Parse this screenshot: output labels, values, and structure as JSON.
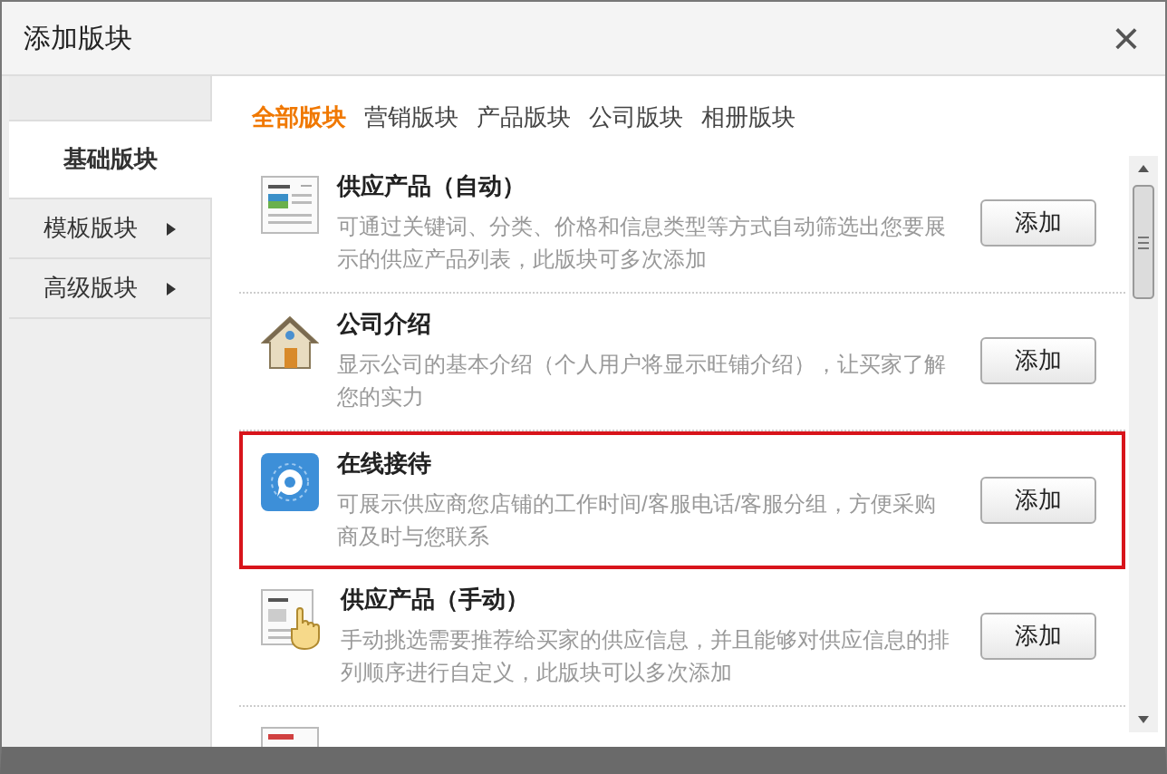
{
  "window": {
    "title": "添加版块",
    "close": "×"
  },
  "sidebar": {
    "items": [
      {
        "label": "基础版块",
        "selected": true,
        "submenu": false
      },
      {
        "label": "模板版块",
        "selected": false,
        "submenu": true
      },
      {
        "label": "高级版块",
        "selected": false,
        "submenu": true
      }
    ]
  },
  "tabs": [
    {
      "label": "全部版块",
      "selected": true
    },
    {
      "label": "营销版块",
      "selected": false
    },
    {
      "label": "产品版块",
      "selected": false
    },
    {
      "label": "公司版块",
      "selected": false
    },
    {
      "label": "相册版块",
      "selected": false
    }
  ],
  "modules": [
    {
      "kind": "document",
      "title": "供应产品（自动）",
      "description": "可通过关键词、分类、价格和信息类型等方式自动筛选出您要展示的供应产品列表，此版块可多次添加",
      "button": "添加",
      "highlighted": false
    },
    {
      "kind": "house",
      "title": "公司介绍",
      "description": "显示公司的基本介绍（个人用户将显示旺铺介绍），让买家了解您的实力",
      "button": "添加",
      "highlighted": false
    },
    {
      "kind": "chat",
      "title": "在线接待",
      "description": "可展示供应商您店铺的工作时间/客服电话/客服分组，方便采购商及时与您联系",
      "button": "添加",
      "highlighted": true
    },
    {
      "kind": "hand",
      "title": "供应产品（手动）",
      "description": "手动挑选需要推荐给买家的供应信息，并且能够对供应信息的排列顺序进行自定义，此版块可以多次添加",
      "button": "添加",
      "highlighted": false
    }
  ]
}
